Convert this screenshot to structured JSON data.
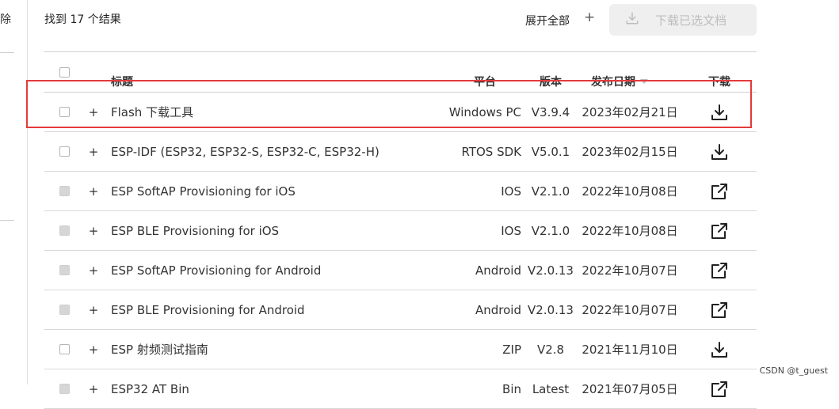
{
  "left_panel": {
    "fragment_label": "除"
  },
  "toolbar": {
    "result_count": "找到 17 个结果",
    "expand_all_label": "展开全部",
    "expand_all_icon": "+",
    "download_selected_label": "下载已选文档",
    "download_selected_icon": "download-icon"
  },
  "table": {
    "headers": {
      "title": "标题",
      "platform": "平台",
      "version": "版本",
      "date": "发布日期",
      "download": "下载"
    },
    "rows": [
      {
        "title": "Flash 下载工具",
        "platform": "Windows PC",
        "version": "V3.9.4",
        "date": "2023年02月21日",
        "action_icon": "download-icon",
        "checkbox_disabled": false,
        "highlighted": true
      },
      {
        "title": "ESP-IDF (ESP32, ESP32-S, ESP32-C, ESP32-H)",
        "platform": "RTOS SDK",
        "version": "V5.0.1",
        "date": "2023年02月15日",
        "action_icon": "download-icon",
        "checkbox_disabled": false
      },
      {
        "title": "ESP SoftAP Provisioning for iOS",
        "platform": "IOS",
        "version": "V2.1.0",
        "date": "2022年10月08日",
        "action_icon": "external-link-icon",
        "checkbox_disabled": true
      },
      {
        "title": "ESP BLE Provisioning for iOS",
        "platform": "IOS",
        "version": "V2.1.0",
        "date": "2022年10月08日",
        "action_icon": "external-link-icon",
        "checkbox_disabled": true
      },
      {
        "title": "ESP SoftAP Provisioning for Android",
        "platform": "Android",
        "version": "V2.0.13",
        "date": "2022年10月07日",
        "action_icon": "external-link-icon",
        "checkbox_disabled": true
      },
      {
        "title": "ESP BLE Provisioning for Android",
        "platform": "Android",
        "version": "V2.0.13",
        "date": "2022年10月07日",
        "action_icon": "external-link-icon",
        "checkbox_disabled": true
      },
      {
        "title": "ESP 射频测试指南",
        "platform": "ZIP",
        "version": "V2.8",
        "date": "2021年11月10日",
        "action_icon": "download-icon",
        "checkbox_disabled": false
      },
      {
        "title": "ESP32 AT Bin",
        "platform": "Bin",
        "version": "Latest",
        "date": "2021年07月05日",
        "action_icon": "external-link-icon",
        "checkbox_disabled": true
      }
    ],
    "expand_icon": "+"
  },
  "watermark": "CSDN @t_guest",
  "colors": {
    "highlight_border": "#e43a3a",
    "disabled_button_bg": "#efefef",
    "disabled_text": "#bdbdbd"
  }
}
